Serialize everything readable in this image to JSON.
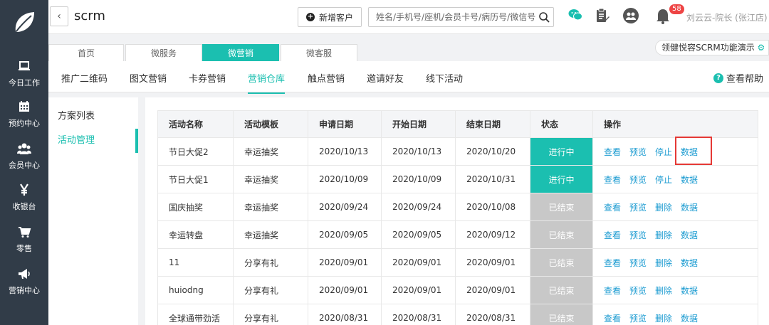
{
  "sidebar": {
    "items": [
      {
        "label": "今日工作",
        "icon": "laptop-icon"
      },
      {
        "label": "预约中心",
        "icon": "calendar-icon"
      },
      {
        "label": "会员中心",
        "icon": "users-icon"
      },
      {
        "label": "收银台",
        "icon": "yen-icon"
      },
      {
        "label": "零售",
        "icon": "cart-icon"
      },
      {
        "label": "营销中心",
        "icon": "megaphone-icon"
      }
    ]
  },
  "header": {
    "back": "‹",
    "title": "scrm",
    "add_customer": "新增客户",
    "search_placeholder": "姓名/手机号/座机/会员卡号/病历号/微信号",
    "notification_count": "58",
    "user": "刘云云-院长 (张江店)"
  },
  "tabs": [
    "首页",
    "微服务",
    "微营销",
    "微客服"
  ],
  "active_tab": "微营销",
  "demo_chip": "领健悦容SCRM功能演示",
  "subnav": [
    "推广二维码",
    "图文营销",
    "卡券营销",
    "营销仓库",
    "触点营销",
    "邀请好友",
    "线下活动"
  ],
  "help": "查看帮助",
  "left_menu": [
    "方案列表",
    "活动管理"
  ],
  "table": {
    "headers": [
      "活动名称",
      "活动模板",
      "申请日期",
      "开始日期",
      "结束日期",
      "状态",
      "操作"
    ],
    "rows": [
      {
        "name": "节日大促2",
        "template": "幸运抽奖",
        "apply": "2020/10/13",
        "start": "2020/10/13",
        "end": "2020/10/20",
        "status": "进行中",
        "ops": [
          "查看",
          "预览",
          "停止",
          "数据"
        ]
      },
      {
        "name": "节日大促1",
        "template": "幸运抽奖",
        "apply": "2020/10/09",
        "start": "2020/10/09",
        "end": "2020/10/31",
        "status": "进行中",
        "ops": [
          "查看",
          "预览",
          "停止",
          "数据"
        ]
      },
      {
        "name": "国庆抽奖",
        "template": "幸运抽奖",
        "apply": "2020/09/24",
        "start": "2020/09/24",
        "end": "2020/10/08",
        "status": "已结束",
        "ops": [
          "查看",
          "预览",
          "删除",
          "数据"
        ]
      },
      {
        "name": "幸运转盘",
        "template": "幸运抽奖",
        "apply": "2020/09/05",
        "start": "2020/09/05",
        "end": "2020/09/12",
        "status": "已结束",
        "ops": [
          "查看",
          "预览",
          "删除",
          "数据"
        ]
      },
      {
        "name": "11",
        "template": "分享有礼",
        "apply": "2020/09/01",
        "start": "2020/09/01",
        "end": "2020/09/01",
        "status": "已结束",
        "ops": [
          "查看",
          "预览",
          "删除",
          "数据"
        ]
      },
      {
        "name": "huiodng",
        "template": "分享有礼",
        "apply": "2020/09/01",
        "start": "2020/09/01",
        "end": "2020/09/01",
        "status": "已结束",
        "ops": [
          "查看",
          "预览",
          "删除",
          "数据"
        ]
      },
      {
        "name": "全球通带劲活",
        "template": "分享有礼",
        "apply": "2020/08/31",
        "start": "2020/08/31",
        "end": "2020/08/31",
        "status": "已结束",
        "ops": [
          "查看",
          "预览",
          "删除",
          "数据"
        ]
      }
    ]
  },
  "colors": {
    "accent": "#1bbfb0",
    "sidebar": "#313c48",
    "link": "#1b9bd1",
    "ended": "#c8c8c8",
    "highlight": "#e53935"
  }
}
